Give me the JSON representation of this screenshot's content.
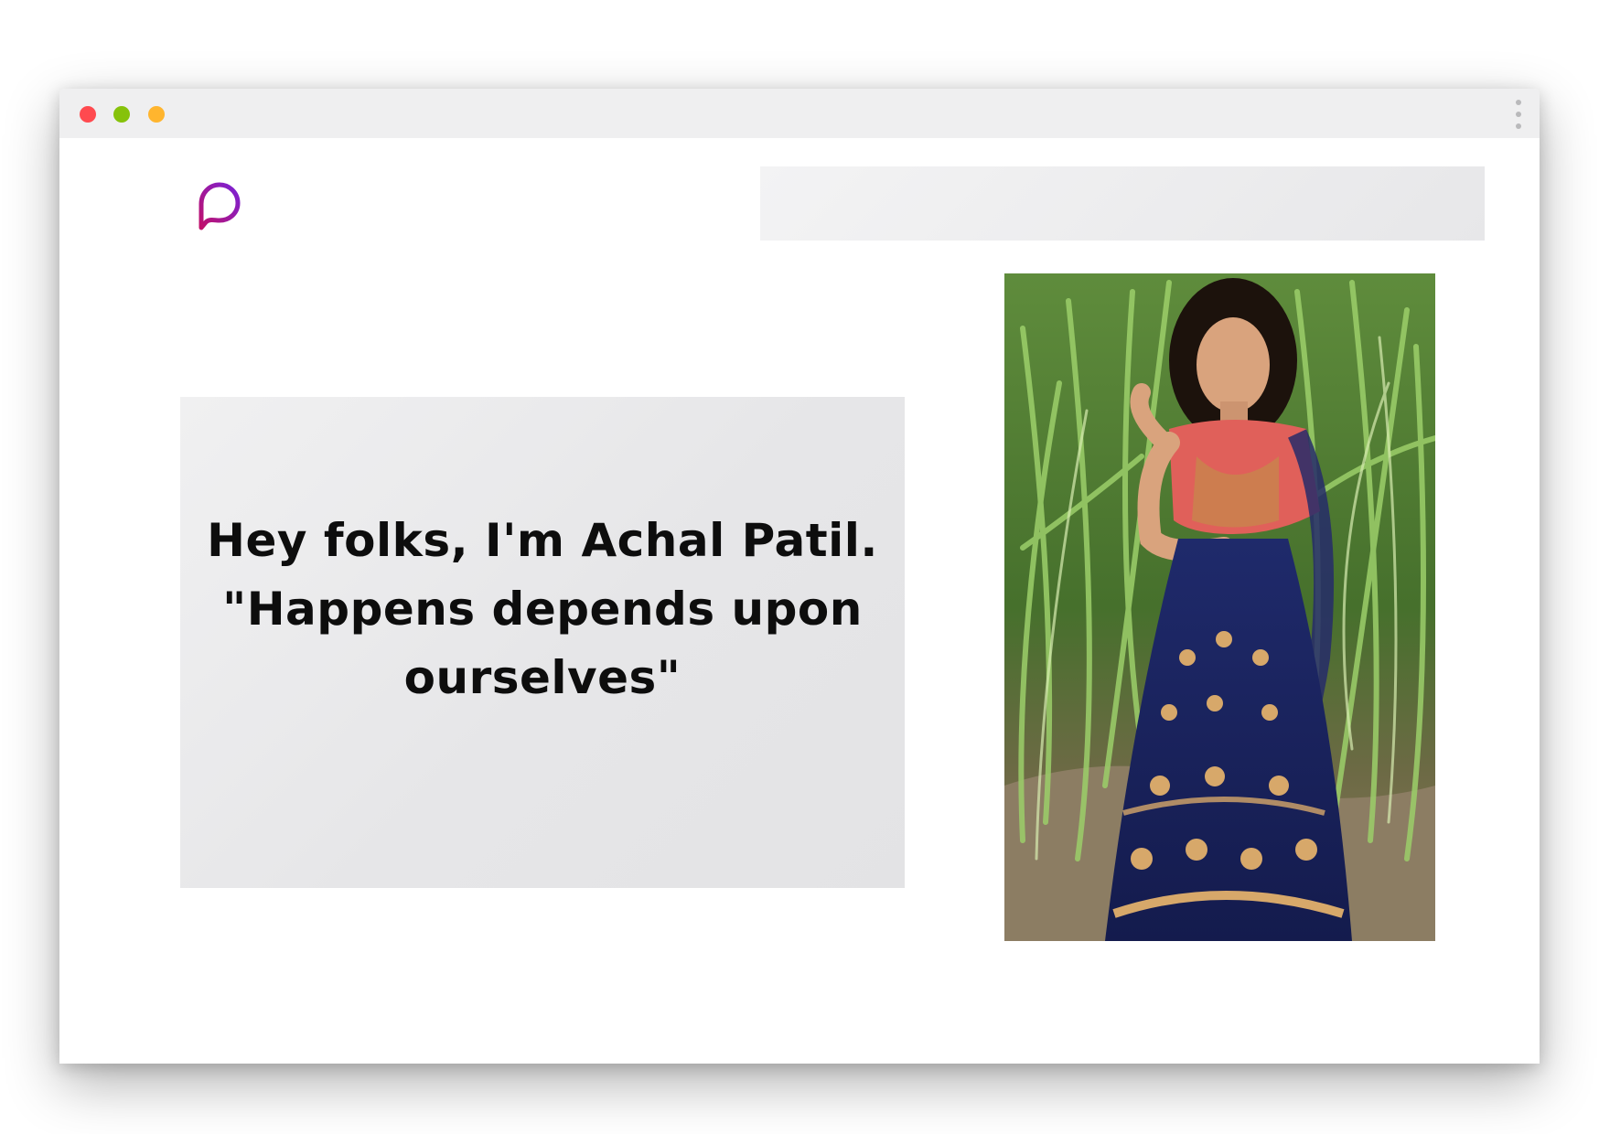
{
  "window": {
    "controls": {
      "close_color": "#ff4a4f",
      "minimize_color": "#86c20b",
      "maximize_color": "#ffb52e"
    },
    "menu_icon": "vertical-dots-icon"
  },
  "header": {
    "logo_icon": "chat-bubble-logo-icon",
    "logo_gradient": [
      "#c0106a",
      "#7a22d6"
    ],
    "search_bar_value": ""
  },
  "intro": {
    "line1": "Hey folks, I'm Achal Patil.",
    "line2": "\"Happens depends upon",
    "line3": "ourselves\""
  },
  "profile_photo": {
    "subject": "woman in red blouse and navy lehenga standing in front of tall grass"
  }
}
